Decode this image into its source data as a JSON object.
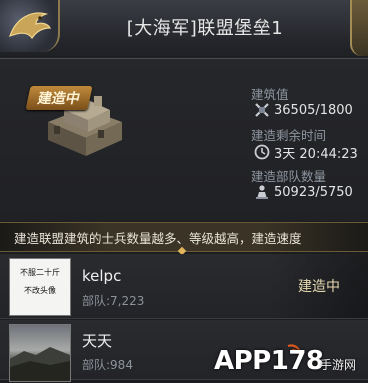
{
  "header": {
    "title": "[大海军]联盟堡垒1",
    "back_icon": "dragon-emblem-icon"
  },
  "building": {
    "status_tag": "建造中",
    "stats": [
      {
        "label": "建筑值",
        "value": "36505/1800",
        "icon": "hammer-cross-icon"
      },
      {
        "label": "建造剩余时间",
        "value": "3天 20:44:23",
        "icon": "clock-icon"
      },
      {
        "label": "建造部队数量",
        "value": "50923/5750",
        "icon": "soldier-icon"
      }
    ]
  },
  "banner": {
    "text": "建造联盟建筑的士兵数量越多、等级越高，建造速度"
  },
  "members": [
    {
      "name": "kelpc",
      "troops": "部队:7,223",
      "status": "建造中",
      "avatar_text": [
        "不服二十斤",
        "不改头像"
      ]
    },
    {
      "name": "天天",
      "troops": "部队:984",
      "status": ""
    }
  ],
  "watermark": {
    "text": "APP178",
    "sub": "手游网"
  }
}
